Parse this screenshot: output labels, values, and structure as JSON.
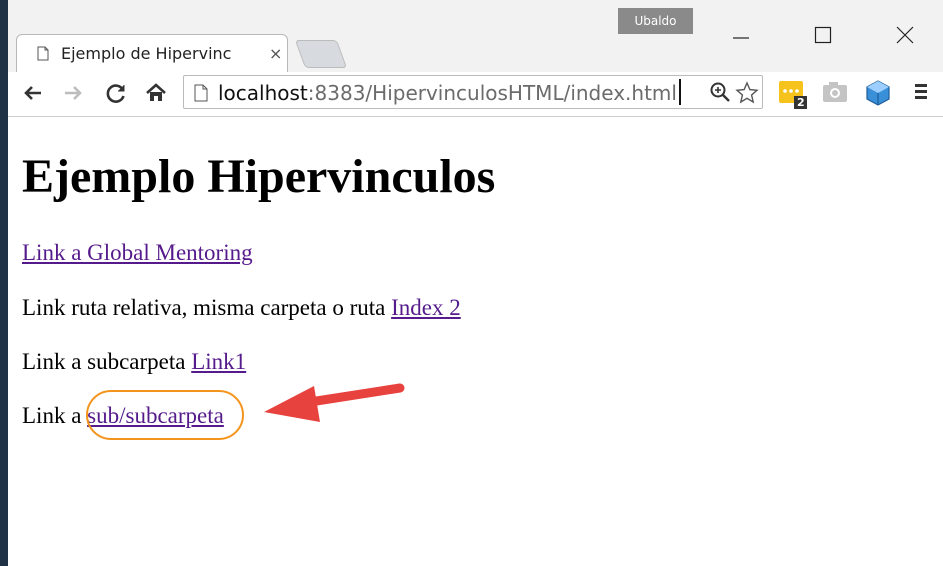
{
  "browser": {
    "profile_name": "Ubaldo",
    "tab": {
      "title": "Ejemplo de Hipervinc",
      "close_glyph": "×"
    },
    "omnibox": {
      "host": "localhost",
      "rest": ":8383/HipervinculosHTML/index.html"
    },
    "extension_badge": "2",
    "accent_colors": {
      "extension_yellow": "#f6c21c",
      "link_visited": "#551a8b"
    }
  },
  "page": {
    "heading": "Ejemplo Hipervinculos",
    "line1": {
      "link": "Link a Global Mentoring"
    },
    "line2": {
      "text": "Link ruta relativa, misma carpeta o ruta ",
      "link": "Index 2"
    },
    "line3": {
      "text": "Link a subcarpeta ",
      "link": "Link1"
    },
    "line4": {
      "text": "Link a ",
      "link": "sub/subcarpeta"
    }
  },
  "annotation": {
    "highlight_color": "#f4941c",
    "arrow_color": "#e8423f"
  },
  "icons": [
    "document-icon",
    "close-icon",
    "minimize-icon",
    "maximize-icon",
    "window-close-icon",
    "back-icon",
    "forward-icon",
    "reload-icon",
    "home-icon",
    "zoom-icon",
    "star-icon",
    "extension-icon",
    "camera-icon",
    "cube-icon",
    "menu-icon"
  ]
}
